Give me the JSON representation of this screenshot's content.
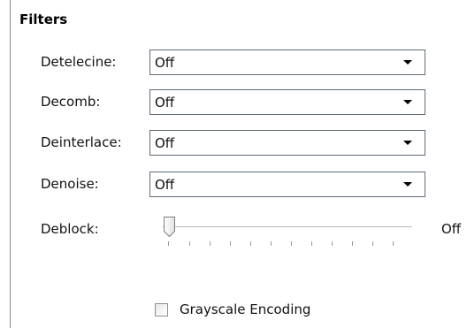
{
  "filters": {
    "title": "Filters",
    "rows": [
      {
        "label": "Detelecine:",
        "value": "Off"
      },
      {
        "label": "Decomb:",
        "value": "Off"
      },
      {
        "label": "Deinterlace:",
        "value": "Off"
      },
      {
        "label": "Denoise:",
        "value": "Off"
      }
    ],
    "deblock": {
      "label": "Deblock:",
      "value": "Off",
      "level": 0
    },
    "grayscale": {
      "label": "Grayscale Encoding",
      "checked": false
    }
  },
  "icons": {
    "dropdown": "chevron-down-icon"
  },
  "colors": {
    "border": "#5f6b78",
    "text": "#111111"
  }
}
